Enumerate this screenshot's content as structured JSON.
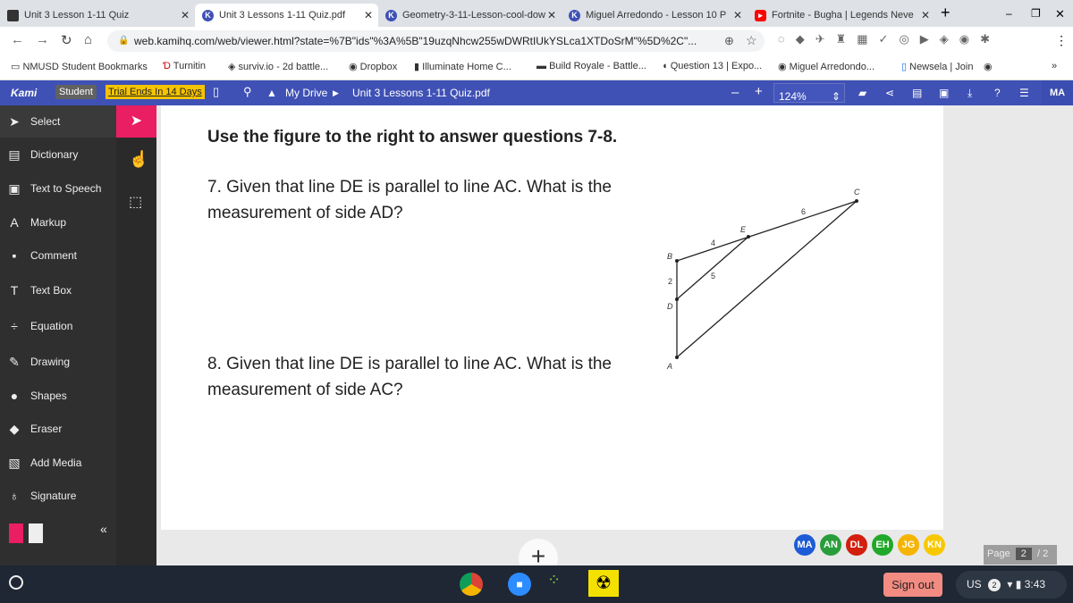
{
  "tabs": [
    {
      "label": "Unit 3 Lesson 1-11 Quiz"
    },
    {
      "label": "Unit 3 Lessons 1-11 Quiz.pdf"
    },
    {
      "label": "Geometry-3-11-Lesson-cool-dow"
    },
    {
      "label": "Miguel Arredondo - Lesson 10 P"
    },
    {
      "label": "Fortnite - Bugha | Legends Neve"
    }
  ],
  "url": "web.kamihq.com/web/viewer.html?state=%7B\"ids\"%3A%5B\"19uzqNhcw255wDWRtIUkYSLca1XTDoSrM\"%5D%2C\"...",
  "bookmarks": [
    "NMUSD Student Bookmarks",
    "Turnitin",
    "surviv.io - 2d battle...",
    "Dropbox",
    "Illuminate Home C...",
    "Build Royale - Battle...",
    "Question 13 | Expo...",
    "Miguel Arredondo...",
    "Newsela | Join"
  ],
  "kami": {
    "logo": "Kami",
    "role": "Student",
    "trial": "Trial Ends In 14 Days",
    "drive": "My Drive",
    "file": "Unit 3 Lessons 1-11 Quiz.pdf",
    "zoom": "124%",
    "user": "MA",
    "accent": "#3f51b5"
  },
  "sidebar": [
    {
      "label": "Select",
      "icon": "cursor-icon"
    },
    {
      "label": "Dictionary",
      "icon": "book-icon"
    },
    {
      "label": "Text to Speech",
      "icon": "speech-icon"
    },
    {
      "label": "Markup",
      "icon": "markup-icon"
    },
    {
      "label": "Comment",
      "icon": "comment-icon"
    },
    {
      "label": "Text Box",
      "icon": "text-icon"
    },
    {
      "label": "Equation",
      "icon": "divide-icon"
    },
    {
      "label": "Drawing",
      "icon": "brush-icon"
    },
    {
      "label": "Shapes",
      "icon": "shapes-icon"
    },
    {
      "label": "Eraser",
      "icon": "eraser-icon"
    },
    {
      "label": "Add Media",
      "icon": "image-icon"
    },
    {
      "label": "Signature",
      "icon": "pen-icon"
    }
  ],
  "doc": {
    "heading": "Use the figure to the right to answer questions 7-8.",
    "q7": [
      "7. Given that line DE is parallel to line AC. What is the",
      "measurement of side AD?"
    ],
    "q8": [
      "8. Given that line DE is parallel to line AC. What is the",
      "measurement of side AC?"
    ],
    "figure": {
      "points": [
        "A",
        "B",
        "C",
        "D",
        "E"
      ],
      "labels": {
        "BE": "4",
        "EC": "6",
        "DE": "5",
        "BD": "2"
      }
    }
  },
  "collaborators": [
    {
      "initials": "MA",
      "color": "#1e5bd6"
    },
    {
      "initials": "AN",
      "color": "#2a9d3b"
    },
    {
      "initials": "DL",
      "color": "#d21f0e"
    },
    {
      "initials": "EH",
      "color": "#22a82a"
    },
    {
      "initials": "JG",
      "color": "#f5b400"
    },
    {
      "initials": "KN",
      "color": "#f7c800"
    }
  ],
  "pager": {
    "label": "Page",
    "current": "2",
    "total": "/ 2"
  },
  "shelf": {
    "signout": "Sign out",
    "locale": "US",
    "notifications": "2",
    "time": "3:43"
  }
}
